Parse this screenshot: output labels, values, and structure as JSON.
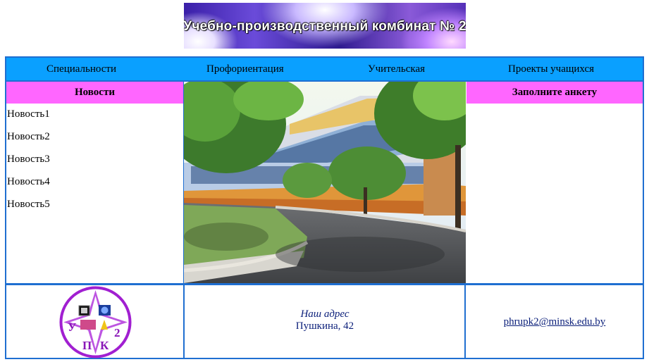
{
  "banner": {
    "title": "Учебно-производственный комбинат № 2"
  },
  "nav": {
    "items": [
      {
        "label": "Специальности"
      },
      {
        "label": "Профориентация"
      },
      {
        "label": "Учительская"
      },
      {
        "label": "Проекты учащихся"
      }
    ]
  },
  "news": {
    "heading": "Новости",
    "items": [
      "Новость1",
      "Новость2",
      "Новость3",
      "Новость4",
      "Новость5"
    ]
  },
  "survey": {
    "heading": "Заполните анкету"
  },
  "footer": {
    "address_title": "Наш адрес",
    "address_line": "Пушкина, 42",
    "email": "phrupk2@minsk.edu.by",
    "logo_letters": [
      "У",
      "П",
      "К",
      "2"
    ]
  },
  "colors": {
    "nav_bg": "#0aa0ff",
    "header_bg": "#ff66ff",
    "border": "#1f6fd1",
    "logo": "#a11fd1"
  }
}
